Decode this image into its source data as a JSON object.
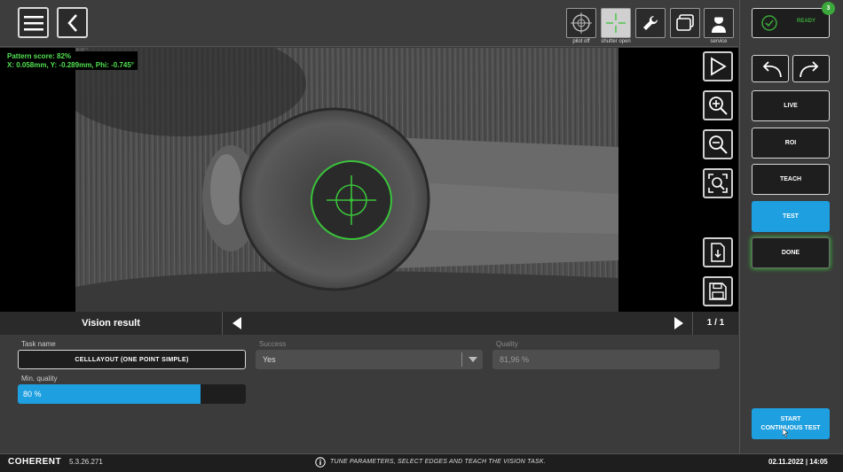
{
  "topbar": {
    "tools": [
      {
        "name": "pilot-off",
        "label": "pilot off",
        "icon": "crosshair-icon"
      },
      {
        "name": "shutter-open",
        "label": "shutter open",
        "icon": "crosshair-green-icon"
      },
      {
        "name": "wrench",
        "label": "",
        "icon": "wrench-icon"
      },
      {
        "name": "window",
        "label": "",
        "icon": "window-icon"
      },
      {
        "name": "service",
        "label": "service",
        "icon": "service-person-icon"
      }
    ]
  },
  "camera": {
    "overlay_line1": "Pattern score: 82%",
    "overlay_line2": "X: 0.058mm, Y: -0.289mm, Phi: -0.745°"
  },
  "result": {
    "title": "Vision result",
    "page": "1 / 1"
  },
  "form": {
    "task_name_label": "Task name",
    "task_name_value": "CELLLAYOUT (ONE POINT SIMPLE)",
    "success_label": "Success",
    "success_value": "Yes",
    "quality_label": "Quality",
    "quality_value": "81,96 %",
    "min_quality_label": "Min. quality",
    "min_quality_value": "80 %",
    "min_quality_fraction": 0.8
  },
  "right": {
    "status_label": "READY",
    "badge_count": "3",
    "buttons": {
      "live": "LIVE",
      "roi": "ROI",
      "teach": "TEACH",
      "test": "TEST",
      "done": "DONE",
      "start_line1": "START",
      "start_line2": "CONTINUOUS TEST"
    }
  },
  "status": {
    "brand": "COHERENT",
    "version": "5.3.26.271",
    "hint": "TUNE PARAMETERS, SELECT EDGES AND TEACH THE VISION TASK.",
    "datetime": "02.11.2022 | 14:05"
  },
  "colors": {
    "accent_blue": "#1e9fe0",
    "ready_green": "#3aa83a",
    "overlay_green": "#52e052"
  }
}
